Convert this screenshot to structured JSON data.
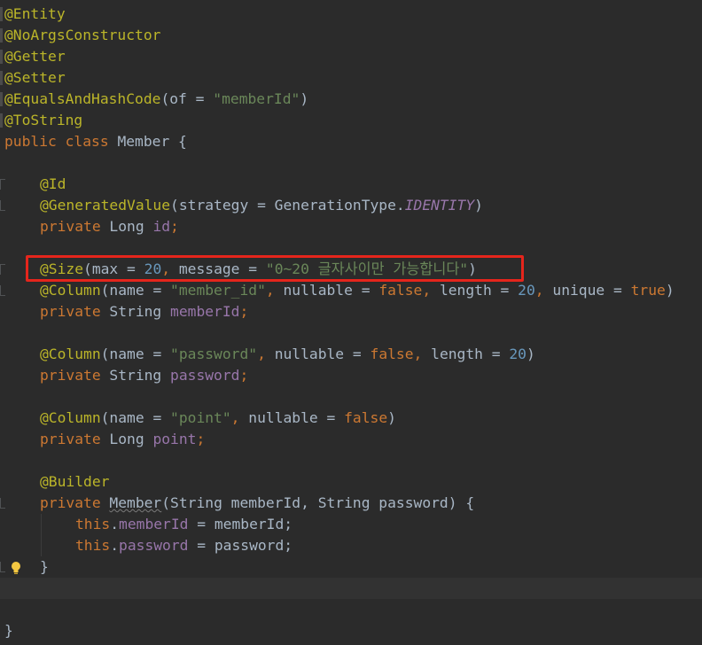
{
  "code": {
    "ann_entity": "@Entity",
    "ann_noargs": "@NoArgsConstructor",
    "ann_getter": "@Getter",
    "ann_setter": "@Setter",
    "ann_equals": "@EqualsAndHashCode",
    "equals_args_open": "(of = ",
    "equals_arg_value": "\"memberId\"",
    "paren_close": ")",
    "ann_tostring": "@ToString",
    "kw_public_class": "public class ",
    "class_name": "Member {",
    "ann_id": "@Id",
    "ann_generated": "@GeneratedValue",
    "generated_args": "(strategy = GenerationType.",
    "generated_identity": "IDENTITY",
    "kw_private": "private ",
    "type_long": "Long ",
    "type_string": "String ",
    "field_id": "id",
    "semicolon": ";",
    "ann_size": "@Size",
    "size_open": "(max = ",
    "size_max": "20",
    "size_comma": ", ",
    "size_message_key": "message = ",
    "size_message": "\"0~20 글자사이만 가능합니다\"",
    "ann_column": "@Column",
    "col_name_open": "(name = ",
    "col_member_id_name": "\"member_id\"",
    "comma": ", ",
    "nullable_eq": "nullable = ",
    "kw_false": "false",
    "length_eq": "length = ",
    "length_20": "20",
    "unique_eq": "unique = ",
    "kw_true": "true",
    "field_member_id": "memberId",
    "col_password_name": "\"password\"",
    "field_password": "password",
    "col_point_name": "\"point\"",
    "field_point": "point",
    "ann_builder": "@Builder",
    "ctor_name": "Member",
    "ctor_params": "(String memberId, String password) {",
    "kw_this": "this",
    "dot": ".",
    "assign_member_id": " = memberId;",
    "assign_password": " = password;",
    "close_brace": "}"
  },
  "colors": {
    "background": "#2b2b2b",
    "annotation": "#bbb529",
    "keyword": "#cc7832",
    "string": "#6a8759",
    "number": "#6897bb",
    "field": "#9876aa",
    "text": "#a9b7c6",
    "highlight_border": "#e5251c"
  },
  "icons": {
    "intention_bulb": "lightbulb-icon"
  }
}
